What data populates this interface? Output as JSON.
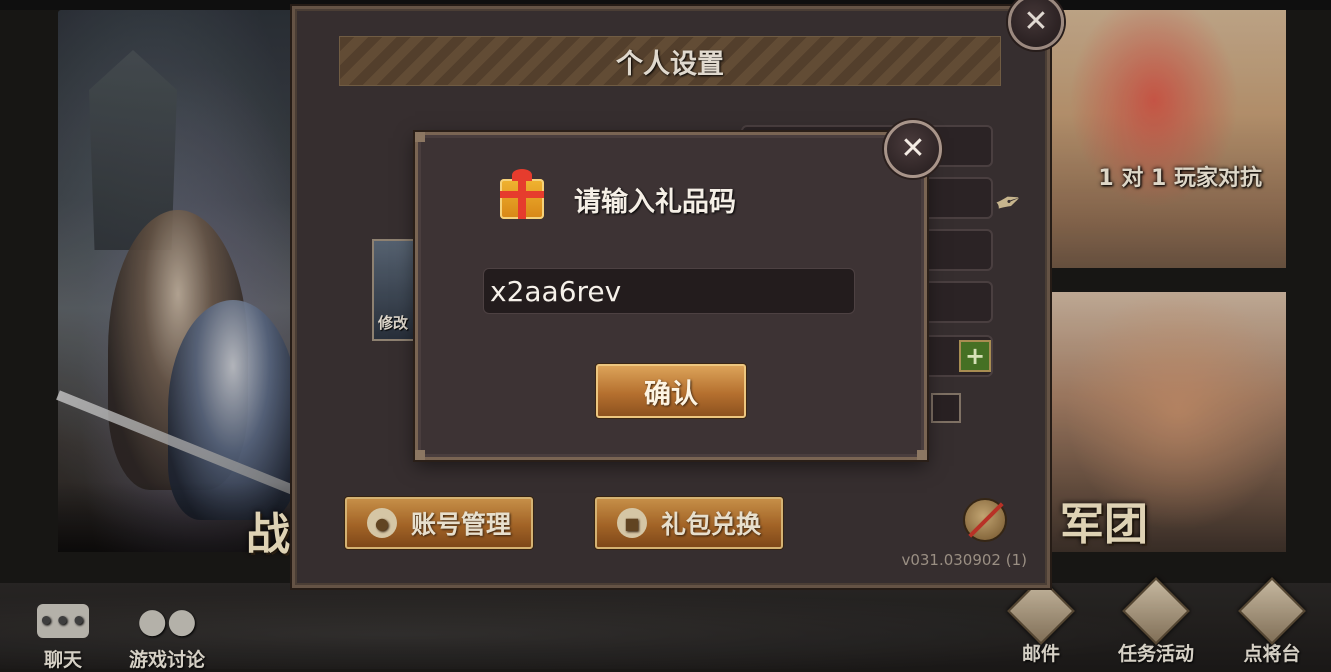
{
  "background": {
    "left_mode_label": "战",
    "right_top_label": "1 对 1 玩家对抗",
    "right_bottom_label": "军团"
  },
  "bottom_bar": {
    "chat_label": "聊天",
    "discussion_label": "游戏讨论",
    "mail_label": "邮件",
    "quests_label": "任务活动",
    "general_label": "点将台"
  },
  "settings_panel": {
    "title": "个人设置",
    "avatar_edit_label": "修改",
    "account_button": "账号管理",
    "gift_exchange_button": "礼包兑换",
    "version": "v031.030902 (1)",
    "plus_icon": "plus-icon",
    "close_icon": "close-icon"
  },
  "gift_dialog": {
    "title": "请输入礼品码",
    "code_value": "x2aa6rev",
    "confirm_button": "确认",
    "icon": "gift-icon"
  },
  "colors": {
    "panel_bg": "#3b3234",
    "button_gold": "#b06c2a",
    "plus_green": "#4b7a28"
  }
}
